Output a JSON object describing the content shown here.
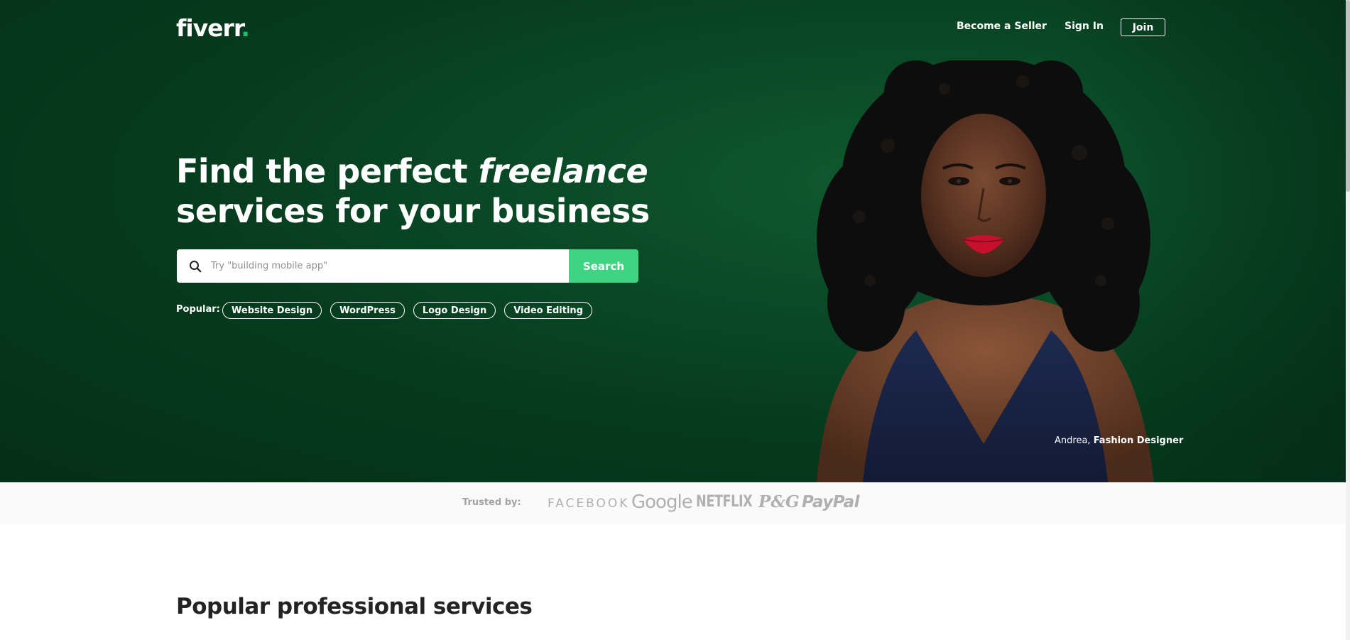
{
  "header": {
    "logo_text": "fiverr",
    "logo_dot": ".",
    "nav": {
      "become_seller": "Become a Seller",
      "sign_in": "Sign In",
      "join": "Join"
    }
  },
  "hero": {
    "headline_part1": "Find the perfect ",
    "headline_emphasis": "freelance",
    "headline_line2": "services for your business",
    "search": {
      "placeholder": "Try \"building mobile app\"",
      "value": "",
      "button_label": "Search"
    },
    "popular": {
      "label": "Popular:",
      "chips": [
        "Website Design",
        "WordPress",
        "Logo Design",
        "Video Editing"
      ]
    },
    "caption": {
      "name": "Andrea, ",
      "role": "Fashion Designer"
    }
  },
  "trusted": {
    "label": "Trusted by:",
    "brands": [
      "FACEBOOK",
      "Google",
      "NETFLIX",
      "P&G",
      "PayPal"
    ]
  },
  "section": {
    "title": "Popular professional services"
  },
  "colors": {
    "hero_bg": "#063a1d",
    "accent": "#1dbf73",
    "search_button": "#3fd483",
    "brand_gray": "#b0b0b0"
  }
}
